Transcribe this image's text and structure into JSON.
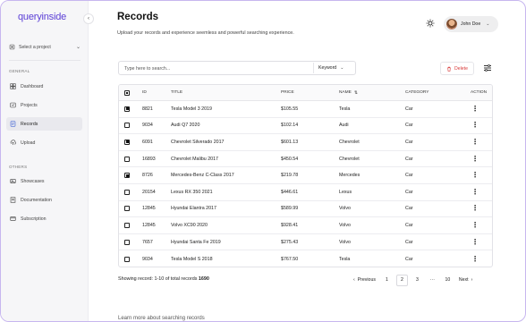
{
  "app": {
    "logo": "queryinside"
  },
  "sidebar": {
    "project_select": "Select a project",
    "groups": [
      {
        "label": "GENERAL",
        "items": [
          {
            "label": "Dashboard",
            "icon": "dashboard-icon",
            "active": false
          },
          {
            "label": "Projects",
            "icon": "projects-icon",
            "active": false
          },
          {
            "label": "Records",
            "icon": "records-icon",
            "active": true
          },
          {
            "label": "Upload",
            "icon": "upload-icon",
            "active": false
          }
        ]
      },
      {
        "label": "OTHERS",
        "items": [
          {
            "label": "Showcases",
            "icon": "showcases-icon",
            "active": false
          },
          {
            "label": "Documentation",
            "icon": "documentation-icon",
            "active": false
          },
          {
            "label": "Subscription",
            "icon": "subscription-icon",
            "active": false
          }
        ]
      }
    ]
  },
  "header": {
    "title": "Records",
    "subtitle": "Upload your records and experience seemless and powerful searching experience.",
    "user_name": "John Doe"
  },
  "toolbar": {
    "search_placeholder": "Type here to search...",
    "search_mode": "Keyword",
    "delete_label": "Delete"
  },
  "table": {
    "columns": {
      "id": "ID",
      "title": "TITLE",
      "price": "PRICE",
      "name": "NAME",
      "category": "CATEGORY",
      "action": "ACTION"
    },
    "rows": [
      {
        "checked": true,
        "id": "8821",
        "title": "Tesla Model 3 2019",
        "price": "$105.55",
        "name": "Tesla",
        "category": "Car"
      },
      {
        "checked": false,
        "id": "9034",
        "title": "Audi Q7 2020",
        "price": "$102.14",
        "name": "Audi",
        "category": "Car"
      },
      {
        "checked": true,
        "id": "6091",
        "title": "Chevrolet Silverado 2017",
        "price": "$601.13",
        "name": "Chevrolet",
        "category": "Car"
      },
      {
        "checked": false,
        "id": "16893",
        "title": "Chevrolet Malibu 2017",
        "price": "$450.54",
        "name": "Chevrolet",
        "category": "Car"
      },
      {
        "checked": true,
        "id": "8726",
        "title": "Mercedes-Benz C-Class 2017",
        "price": "$219.78",
        "name": "Mercedes",
        "category": "Car"
      },
      {
        "checked": false,
        "id": "20154",
        "title": "Lexus RX 350 2021",
        "price": "$446.61",
        "name": "Lexus",
        "category": "Car"
      },
      {
        "checked": false,
        "id": "12845",
        "title": "Hyundai Elantra 2017",
        "price": "$589.99",
        "name": "Volvo",
        "category": "Car"
      },
      {
        "checked": false,
        "id": "12845",
        "title": "Volvo XC90 2020",
        "price": "$928.41",
        "name": "Volvo",
        "category": "Car"
      },
      {
        "checked": false,
        "id": "7657",
        "title": "Hyundai Santa Fe 2019",
        "price": "$275.43",
        "name": "Volvo",
        "category": "Car"
      },
      {
        "checked": false,
        "id": "9034",
        "title": "Tesla Model S 2018",
        "price": "$767.50",
        "name": "Tesla",
        "category": "Car"
      }
    ]
  },
  "footer": {
    "showing_prefix": "Showing record: 1-10 of total records ",
    "total": "1690",
    "previous": "Previous",
    "next": "Next",
    "pages": [
      "1",
      "2",
      "3",
      "···",
      "10"
    ],
    "active_page": "2"
  },
  "learn_more": "Learn more about searching records",
  "colors": {
    "brand": "#5b3fd6",
    "danger": "#d83a3a",
    "frame": "#c7b6ef"
  }
}
